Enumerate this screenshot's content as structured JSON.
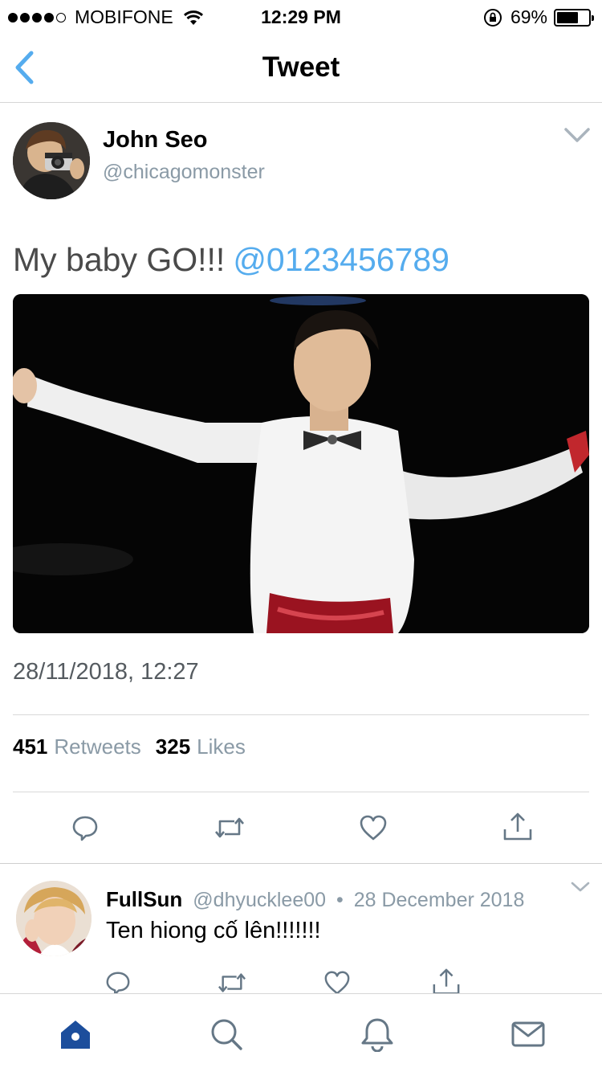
{
  "status_bar": {
    "carrier": "MOBIFONE",
    "time": "12:29 PM",
    "battery_text": "69%",
    "battery_level": 0.69
  },
  "nav": {
    "title": "Tweet",
    "back_icon": "chevron-left-icon"
  },
  "tweet": {
    "author_name": "John Seo",
    "author_handle": "@chicagomonster",
    "text": "My baby GO!!!",
    "mention": "@0123456789",
    "timestamp": "28/11/2018, 12:27",
    "retweet_count": "451",
    "retweet_label": "Retweets",
    "like_count": "325",
    "like_label": "Likes",
    "actions": [
      "reply-icon",
      "retweet-icon",
      "like-icon",
      "share-icon"
    ]
  },
  "reply": {
    "name": "FullSun",
    "handle": "@dhyucklee00",
    "separator": "•",
    "date": "28 December 2018",
    "text": "Ten hiong cố lên!!!!!!!"
  },
  "tab_bar": {
    "tabs": [
      "home-icon",
      "search-icon",
      "notifications-icon",
      "messages-icon"
    ],
    "active": "home-icon"
  },
  "colors": {
    "accent": "#55acee",
    "secondary_text": "#8a9aa6",
    "icon_gray": "#657786",
    "active_tab": "#1c4e9c"
  }
}
